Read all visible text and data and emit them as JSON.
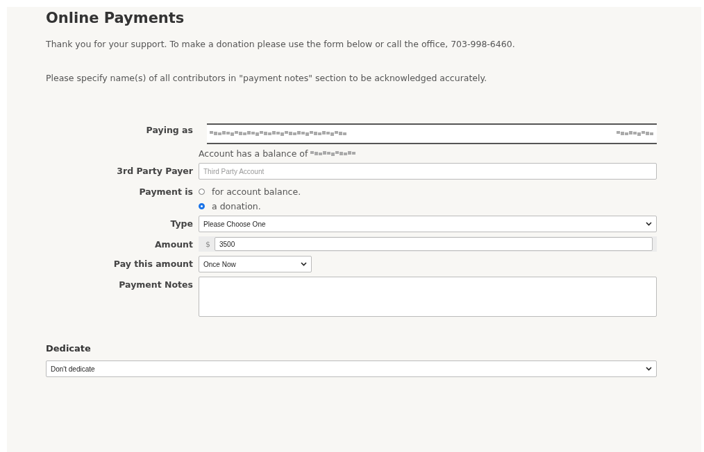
{
  "title": "Online Payments",
  "intro": [
    "Thank you for your support. To make a donation please use the form below or call the office, 703-998-6460.",
    "Please specify name(s) of all contributors in \"payment notes\" section to be acknowledged accurately."
  ],
  "form": {
    "paying_as": {
      "label": "Paying as"
    },
    "balance_note": "Account has a balance of",
    "third_party": {
      "label": "3rd Party Payer",
      "placeholder": "Third Party Account"
    },
    "payment_is": {
      "label": "Payment is",
      "options": [
        {
          "label": "for account balance.",
          "selected": false
        },
        {
          "label": "a donation.",
          "selected": true
        }
      ]
    },
    "type": {
      "label": "Type",
      "value": "Please Choose One"
    },
    "amount": {
      "label": "Amount",
      "prefix": "$",
      "value": "3500"
    },
    "pay_this_amount": {
      "label": "Pay this amount",
      "value": "Once Now"
    },
    "payment_notes": {
      "label": "Payment Notes"
    }
  },
  "dedicate": {
    "heading": "Dedicate",
    "value": "Don't dedicate"
  }
}
